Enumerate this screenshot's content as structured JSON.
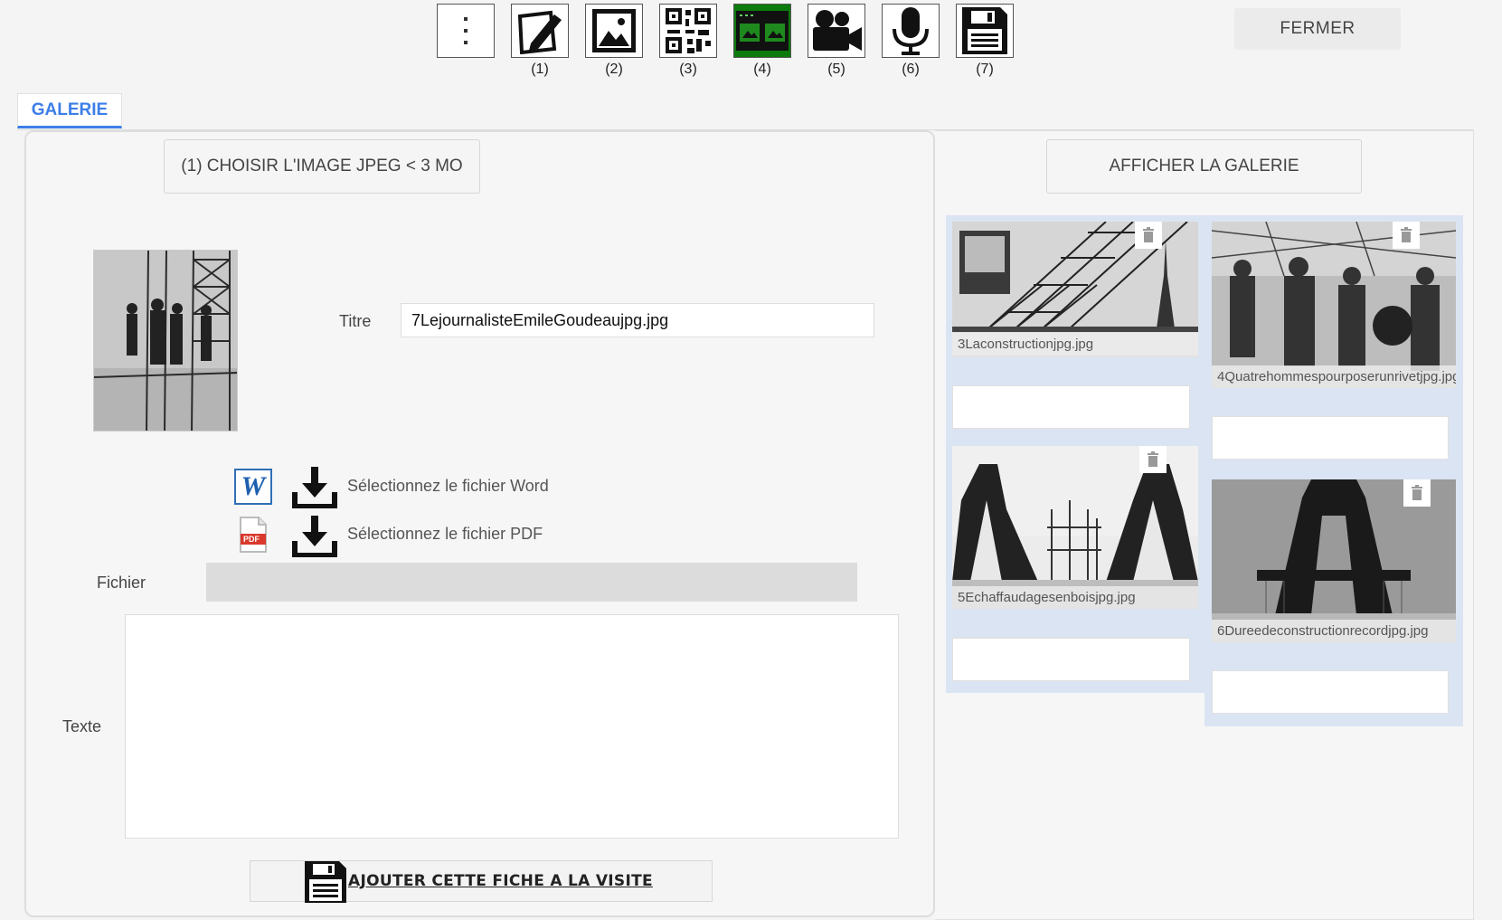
{
  "toolbar": {
    "buttons": [
      {
        "icon": "more-vert-icon",
        "num": ""
      },
      {
        "icon": "edit-icon",
        "num": "(1)"
      },
      {
        "icon": "image-icon",
        "num": "(2)"
      },
      {
        "icon": "qr-code-icon",
        "num": "(3)"
      },
      {
        "icon": "gallery-icon",
        "num": "(4)"
      },
      {
        "icon": "video-camera-icon",
        "num": "(5)"
      },
      {
        "icon": "microphone-icon",
        "num": "(6)"
      },
      {
        "icon": "save-icon",
        "num": "(7)"
      }
    ],
    "close_label": "FERMER"
  },
  "tab": {
    "label": "GALERIE"
  },
  "form": {
    "choose_image_label": "(1) CHOISIR L'IMAGE JPEG < 3 MO",
    "titre_label": "Titre",
    "titre_value": "7LejournalisteEmileGoudeaujpg.jpg",
    "word_label": "Sélectionnez le fichier Word",
    "pdf_label": "Sélectionnez le fichier PDF",
    "fichier_label": "Fichier",
    "texte_label": "Texte",
    "pdf_badge": "PDF",
    "word_badge": "W",
    "add_button_label": "AJOUTER CETTE FICHE A LA VISITE"
  },
  "gallery": {
    "show_label": "AFFICHER LA GALERIE",
    "items": [
      {
        "caption": "3Laconstructionjpg.jpg"
      },
      {
        "caption": "4Quatrehommespourposerunrivetjpg.jpg"
      },
      {
        "caption": "5Echaffaudagesenboisjpg.jpg"
      },
      {
        "caption": "6Dureedeconstructionrecordjpg.jpg"
      }
    ]
  },
  "colors": {
    "accent": "#3c7ee8",
    "active_tool": "#0c7a0c",
    "gallery_bg": "#dbe4f3"
  }
}
